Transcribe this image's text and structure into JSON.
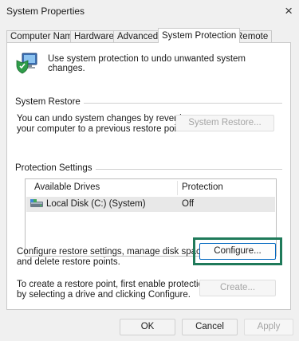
{
  "window": {
    "title": "System Properties",
    "close_glyph": "×"
  },
  "tabs": [
    {
      "label": "Computer Name"
    },
    {
      "label": "Hardware"
    },
    {
      "label": "Advanced"
    },
    {
      "label": "System Protection",
      "active": true
    },
    {
      "label": "Remote"
    }
  ],
  "intro": {
    "icon": "system-protection-icon",
    "text": "Use system protection to undo unwanted system changes."
  },
  "system_restore": {
    "group_label": "System Restore",
    "description_line1": "You can undo system changes by reverting",
    "description_line2": "your computer to a previous restore point.",
    "button_label": "System Restore..."
  },
  "protection_settings": {
    "group_label": "Protection Settings",
    "columns": [
      "Available Drives",
      "Protection"
    ],
    "drives": [
      {
        "name": "Local Disk (C:) (System)",
        "protection": "Off",
        "icon": "drive-icon"
      }
    ],
    "configure_text_line1": "Configure restore settings, manage disk space,",
    "configure_text_line2": "and delete restore points.",
    "configure_button": "Configure...",
    "create_text_line1": "To create a restore point, first enable protection",
    "create_text_line2": "by selecting a drive and clicking Configure.",
    "create_button": "Create..."
  },
  "footer": {
    "ok": "OK",
    "cancel": "Cancel",
    "apply": "Apply"
  },
  "colors": {
    "highlight": "#1f7a5a",
    "accent": "#0067c0"
  }
}
